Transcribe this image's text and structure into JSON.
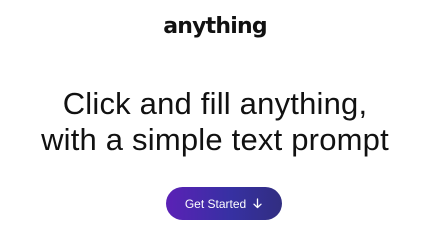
{
  "brand": {
    "logo_text": "anything"
  },
  "hero": {
    "line1": "Click and fill anything,",
    "line2": "with a simple text prompt"
  },
  "cta": {
    "label": "Get Started",
    "icon": "arrow-down-icon"
  },
  "colors": {
    "background": "#ffffff",
    "text": "#111111",
    "button_start": "#5b21b6",
    "button_end": "#312e81",
    "button_text": "#ffffff"
  }
}
